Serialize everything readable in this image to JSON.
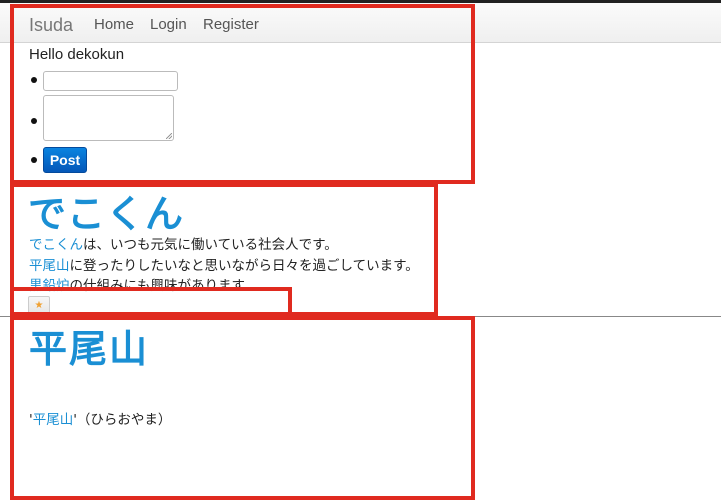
{
  "navbar": {
    "brand": "Isuda",
    "links": [
      "Home",
      "Login",
      "Register"
    ]
  },
  "greeting": "Hello dekokun",
  "form": {
    "keyword_value": "",
    "description_value": "",
    "post_label": "Post"
  },
  "entries": [
    {
      "title": "でこくん",
      "lines": [
        {
          "link": "でこくん",
          "text": "は、いつも元気に働いている社会人です。"
        },
        {
          "link": "平尾山",
          "text": "に登ったりしたいなと思いながら日々を過ごしています。"
        },
        {
          "link": "黒鉛炉",
          "text": "の仕組みにも興味があります"
        }
      ],
      "star_label": "★"
    },
    {
      "title": "平尾山",
      "line": {
        "prefix": "'",
        "link": "平尾山",
        "suffix": "'（ひらおやま）"
      }
    }
  ],
  "colors": {
    "link": "#1a8fd4",
    "highlight_box": "#e02a1f",
    "post_button": "#0a6fd0"
  }
}
